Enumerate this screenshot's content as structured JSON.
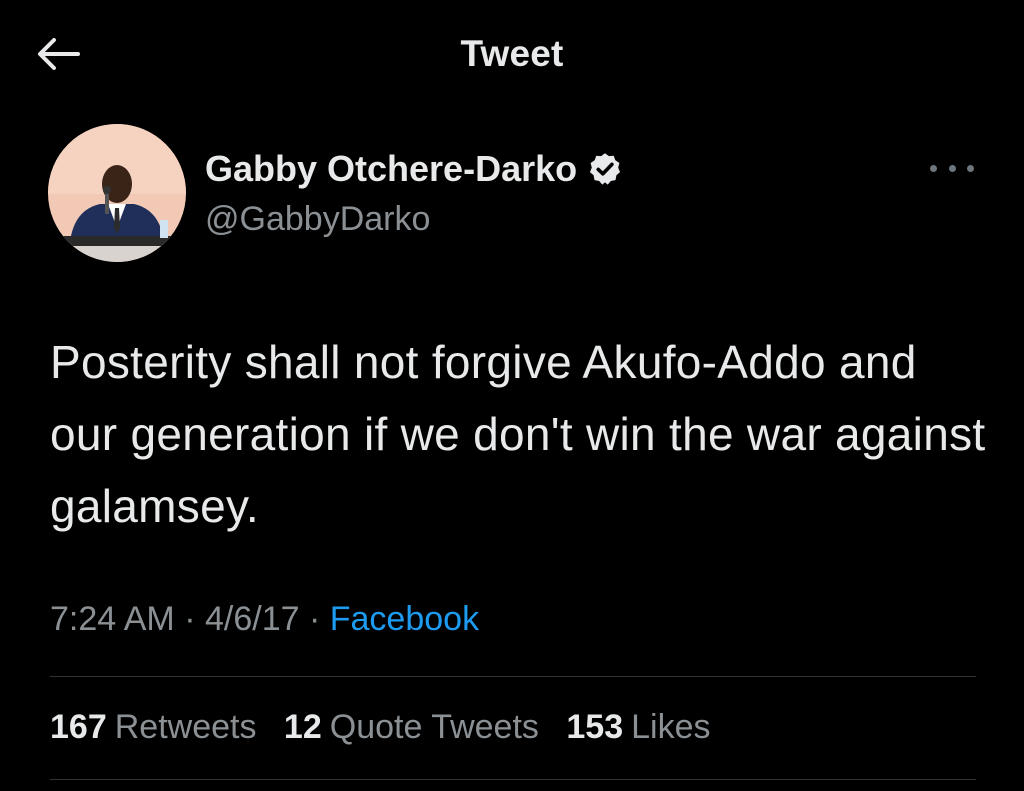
{
  "header": {
    "title": "Tweet",
    "back_icon": "arrow-left-icon"
  },
  "author": {
    "display_name": "Gabby Otchere-Darko",
    "handle": "@GabbyDarko",
    "verified": true,
    "verified_icon": "verified-badge-icon",
    "more_icon": "more-horizontal-icon"
  },
  "tweet": {
    "text": "Posterity shall not forgive Akufo-Addo and our generation if we don't win the war against galamsey.",
    "time": "7:24 AM",
    "separator": "·",
    "date": "4/6/17",
    "source": "Facebook"
  },
  "stats": {
    "retweets_count": "167",
    "retweets_label": "Retweets",
    "quotes_count": "12",
    "quotes_label": "Quote Tweets",
    "likes_count": "153",
    "likes_label": "Likes"
  },
  "colors": {
    "background": "#000000",
    "text_primary": "#e7e9ea",
    "text_secondary": "#8b9095",
    "accent": "#1d9bf0",
    "divider": "#2f3336"
  }
}
